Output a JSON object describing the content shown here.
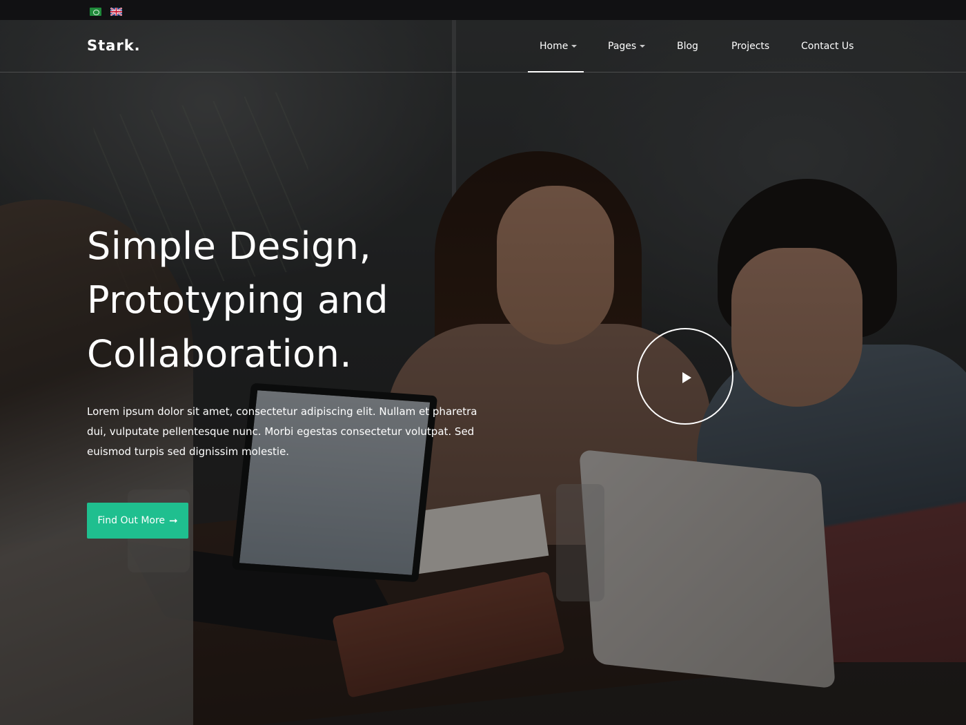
{
  "topbar": {
    "languages": [
      {
        "name": "arabic-flag-icon"
      },
      {
        "name": "uk-flag-icon"
      }
    ]
  },
  "header": {
    "logo": "Stark."
  },
  "nav": {
    "items": [
      {
        "label": "Home",
        "has_dropdown": true,
        "active": true
      },
      {
        "label": "Pages",
        "has_dropdown": true,
        "active": false
      },
      {
        "label": "Blog",
        "has_dropdown": false,
        "active": false
      },
      {
        "label": "Projects",
        "has_dropdown": false,
        "active": false
      },
      {
        "label": "Contact Us",
        "has_dropdown": false,
        "active": false
      }
    ]
  },
  "hero": {
    "title_lines": [
      "Simple Design,",
      "Prototyping and",
      "Collaboration."
    ],
    "description": "Lorem ipsum dolor sit amet, consectetur adipiscing elit. Nullam et pharetra dui, vulputate pellentesque nunc. Morbi egestas consectetur volutpat. Sed euismod turpis sed dignissim molestie.",
    "cta_label": "Find Out More",
    "cta_icon": "arrow-right-icon",
    "play_icon": "play-icon"
  },
  "colors": {
    "accent": "#1fbf8f",
    "topbar": "#111113",
    "text": "#ffffff"
  }
}
